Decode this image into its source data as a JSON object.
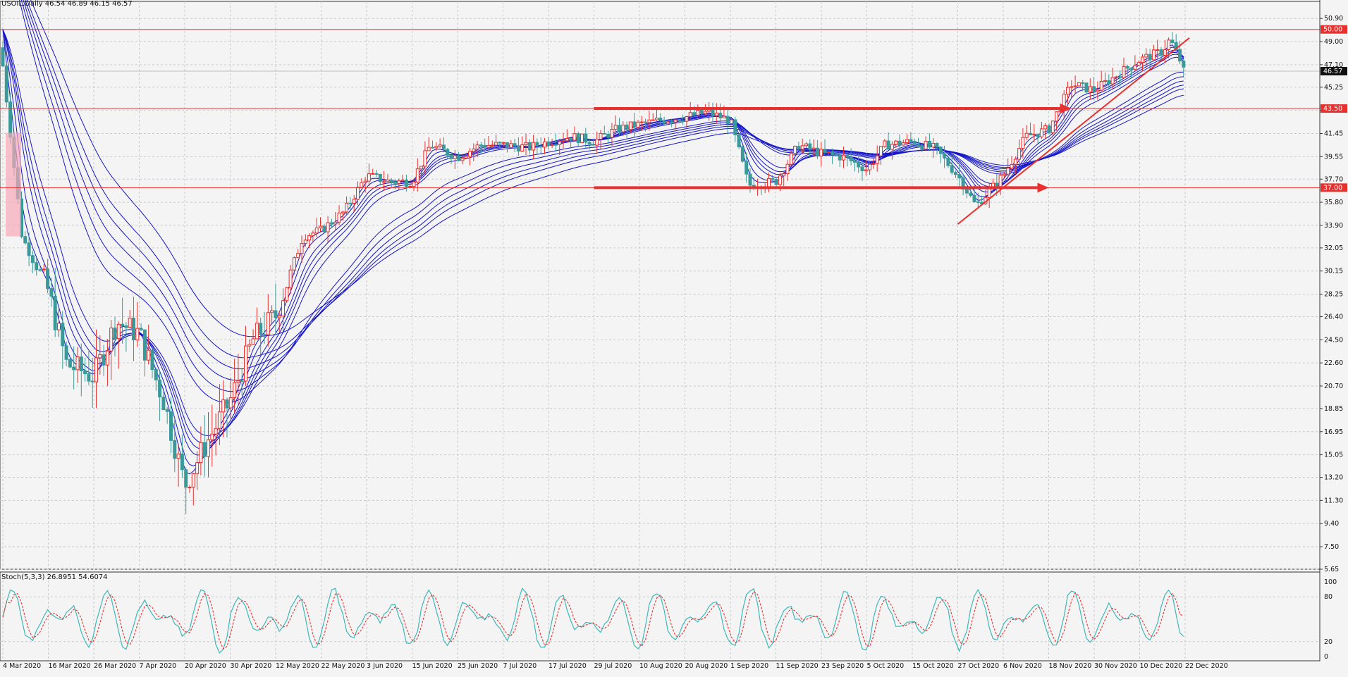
{
  "header": {
    "symbol_timeframe": "USOIL,Daily",
    "ohlc": "46.54 46.89 46.15 46.57"
  },
  "indicator": {
    "label": "Stoch(5,3,3) 26.8951 54.6074"
  },
  "colors": {
    "bull_candle": "#e8312f",
    "bear_candle": "#3a9a9a",
    "ma_ribbon": "#1616c8",
    "level_line": "#e8312f",
    "stoch_main": "#3fb8b8",
    "stoch_signal": "#e8312f",
    "grid": "#c9c9c9",
    "background": "#f4f4f4"
  },
  "chart_data": [
    {
      "type": "candlestick",
      "title": "",
      "price_axis_ticks": [
        50.9,
        49.0,
        47.1,
        45.25,
        43.35,
        41.45,
        39.55,
        37.7,
        35.8,
        33.9,
        32.05,
        30.15,
        28.25,
        26.4,
        24.5,
        22.6,
        20.7,
        18.85,
        16.95,
        15.05,
        13.2,
        11.3,
        9.4,
        7.5,
        5.65
      ],
      "ylim": [
        5.65,
        52.3
      ],
      "date_axis_ticks": [
        "4 Mar 2020",
        "16 Mar 2020",
        "26 Mar 2020",
        "7 Apr 2020",
        "20 Apr 2020",
        "30 Apr 2020",
        "12 May 2020",
        "22 May 2020",
        "3 Jun 2020",
        "15 Jun 2020",
        "25 Jun 2020",
        "7 Jul 2020",
        "17 Jul 2020",
        "29 Jul 2020",
        "10 Aug 2020",
        "20 Aug 2020",
        "1 Sep 2020",
        "11 Sep 2020",
        "23 Sep 2020",
        "5 Oct 2020",
        "15 Oct 2020",
        "27 Oct 2020",
        "6 Nov 2020",
        "18 Nov 2020",
        "30 Nov 2020",
        "10 Dec 2020",
        "22 Dec 2020"
      ],
      "current_price_label": "46.57",
      "horizontal_levels": [
        {
          "value": 50.0,
          "label": "50.00"
        },
        {
          "value": 43.5,
          "label": "43.50"
        },
        {
          "value": 37.0,
          "label": "37.00"
        }
      ],
      "close_path": [
        [
          "4 Mar 2020",
          47.0
        ],
        [
          "9 Mar 2020",
          33.0
        ],
        [
          "16 Mar 2020",
          28.5
        ],
        [
          "20 Mar 2020",
          22.5
        ],
        [
          "26 Mar 2020",
          21.5
        ],
        [
          "1 Apr 2020",
          26.0
        ],
        [
          "7 Apr 2020",
          25.0
        ],
        [
          "14 Apr 2020",
          19.5
        ],
        [
          "20 Apr 2020",
          12.5
        ],
        [
          "24 Apr 2020",
          15.5
        ],
        [
          "30 Apr 2020",
          19.5
        ],
        [
          "6 May 2020",
          24.5
        ],
        [
          "12 May 2020",
          26.5
        ],
        [
          "18 May 2020",
          33.0
        ],
        [
          "22 May 2020",
          33.5
        ],
        [
          "28 May 2020",
          35.0
        ],
        [
          "3 Jun 2020",
          38.0
        ],
        [
          "9 Jun 2020",
          37.5
        ],
        [
          "15 Jun 2020",
          37.5
        ],
        [
          "19 Jun 2020",
          40.5
        ],
        [
          "25 Jun 2020",
          39.5
        ],
        [
          "1 Jul 2020",
          40.5
        ],
        [
          "7 Jul 2020",
          40.5
        ],
        [
          "13 Jul 2020",
          40.3
        ],
        [
          "17 Jul 2020",
          40.8
        ],
        [
          "23 Jul 2020",
          41.2
        ],
        [
          "29 Jul 2020",
          40.8
        ],
        [
          "4 Aug 2020",
          41.8
        ],
        [
          "10 Aug 2020",
          42.2
        ],
        [
          "14 Aug 2020",
          42.5
        ],
        [
          "20 Aug 2020",
          42.8
        ],
        [
          "26 Aug 2020",
          43.2
        ],
        [
          "1 Sep 2020",
          42.5
        ],
        [
          "5 Sep 2020",
          37.2
        ],
        [
          "11 Sep 2020",
          37.5
        ],
        [
          "17 Sep 2020",
          40.5
        ],
        [
          "23 Sep 2020",
          39.8
        ],
        [
          "29 Sep 2020",
          39.5
        ],
        [
          "5 Oct 2020",
          38.5
        ],
        [
          "9 Oct 2020",
          40.5
        ],
        [
          "15 Oct 2020",
          40.8
        ],
        [
          "21 Oct 2020",
          40.2
        ],
        [
          "27 Oct 2020",
          38.0
        ],
        [
          "31 Oct 2020",
          35.5
        ],
        [
          "6 Nov 2020",
          38.0
        ],
        [
          "12 Nov 2020",
          41.2
        ],
        [
          "18 Nov 2020",
          41.8
        ],
        [
          "24 Nov 2020",
          45.5
        ],
        [
          "30 Nov 2020",
          45.0
        ],
        [
          "4 Dec 2020",
          46.0
        ],
        [
          "10 Dec 2020",
          47.5
        ],
        [
          "16 Dec 2020",
          48.2
        ],
        [
          "18 Dec 2020",
          49.2
        ],
        [
          "22 Dec 2020",
          46.57
        ]
      ],
      "moving_average_ribbon": "12 blue moving averages trailing price (short to long periods)",
      "trendline": {
        "from": [
          "27 Oct 2020",
          34.0
        ],
        "to": [
          "22 Dec 2020",
          49.3
        ]
      },
      "arrows": [
        {
          "level": 43.5,
          "from": "29 Jul 2020",
          "to": "24 Nov 2020"
        },
        {
          "level": 37.0,
          "from": "29 Jul 2020",
          "to": "18 Nov 2020"
        }
      ],
      "grid": true
    },
    {
      "type": "line",
      "title": "Stoch(5,3,3)",
      "y_axis_ticks": [
        100,
        80,
        20,
        0
      ],
      "ylim": [
        0,
        100
      ],
      "series": [
        {
          "name": "Stoch(5,3,3) main",
          "last_value": 26.8951
        },
        {
          "name": "Stoch(5,3,3) signal",
          "last_value": 54.6074
        }
      ]
    }
  ]
}
